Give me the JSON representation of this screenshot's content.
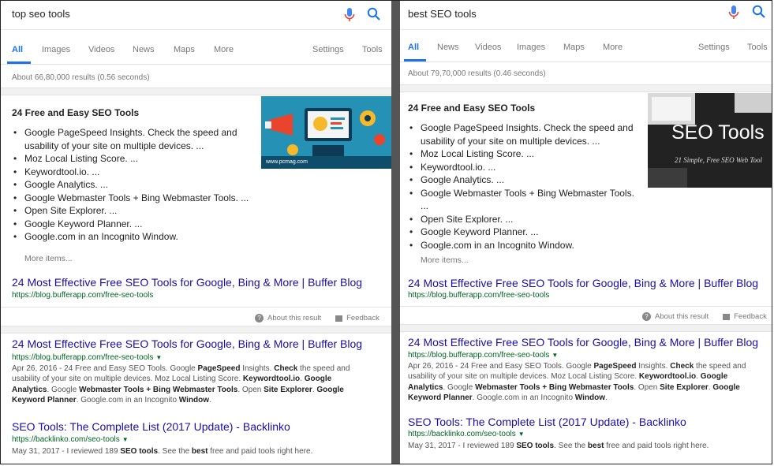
{
  "left": {
    "query": "top seo tools",
    "tabs": [
      "All",
      "Images",
      "Videos",
      "News",
      "Maps",
      "More"
    ],
    "settings_tabs": [
      "Settings",
      "Tools"
    ],
    "stats": "About 66,80,000 results (0.56 seconds)",
    "snippet": {
      "title": "24 Free and Easy SEO Tools",
      "items": [
        "Google PageSpeed Insights. Check the speed and",
        "usability of your site on multiple devices. ...",
        "Moz Local Listing Score. ...",
        "Keywordtool.io. ...",
        "Google Analytics. ...",
        "Google Webmaster Tools + Bing Webmaster Tools. ...",
        "Open Site Explorer. ...",
        "Google Keyword Planner. ...",
        "Google.com in an Incognito Window."
      ],
      "more": "More items...",
      "image_caption": "www.pcmag.com"
    },
    "featured_title": "24 Most Effective Free SEO Tools for Google, Bing & More | Buffer Blog",
    "featured_url": "https://blog.bufferapp.com/free-seo-tools",
    "about": "About this result",
    "feedback": "Feedback",
    "results": [
      {
        "title": "24 Most Effective Free SEO Tools for Google, Bing & More | Buffer Blog",
        "url": "https://blog.bufferapp.com/free-seo-tools",
        "desc_html": "Apr 26, 2016 - 24 Free and Easy SEO Tools. Google <b>PageSpeed</b> Insights. <b>Check</b> the speed and usability of your site on multiple devices. Moz Local Listing Score. <b>Keywordtool.io</b>. <b>Google Analytics</b>. Google <b>Webmaster Tools + Bing Webmaster Tools</b>. Open <b>Site Explorer</b>. <b>Google Keyword Planner</b>. Google.com in an Incognito <b>Window</b>."
      },
      {
        "title": "SEO Tools: The Complete List (2017 Update) - Backlinko",
        "url": "https://backlinko.com/seo-tools",
        "desc_html": "May 31, 2017 - I reviewed 189 <b>SEO tools</b>. See the <b>best</b> free and paid tools right here."
      }
    ]
  },
  "right": {
    "query": "best SEO tools",
    "tabs": [
      "All",
      "News",
      "Videos",
      "Images",
      "Maps",
      "More"
    ],
    "settings_tabs": [
      "Settings",
      "Tools"
    ],
    "stats": "About 79,70,000 results (0.46 seconds)",
    "snippet": {
      "title": "24 Free and Easy SEO Tools",
      "items": [
        "Google PageSpeed Insights. Check the speed and",
        "usability of your site on multiple devices. ...",
        "Moz Local Listing Score. ...",
        "Keywordtool.io. ...",
        "Google Analytics. ...",
        "Google Webmaster Tools + Bing Webmaster Tools.",
        "...",
        "Open Site Explorer. ...",
        "Google Keyword Planner. ...",
        "Google.com in an Incognito Window."
      ],
      "more": "More items...",
      "image_title": "SEO Tools",
      "image_subtitle": "21 Simple, Free SEO Web Tool"
    },
    "featured_title": "24 Most Effective Free SEO Tools for Google, Bing & More | Buffer Blog",
    "featured_url": "https://blog.bufferapp.com/free-seo-tools",
    "about": "About this result",
    "feedback": "Feedback",
    "results": [
      {
        "title": "24 Most Effective Free SEO Tools for Google, Bing & More | Buffer Blog",
        "url": "https://blog.bufferapp.com/free-seo-tools",
        "desc_html": "Apr 26, 2016 - 24 Free and Easy SEO Tools. Google <b>PageSpeed</b> Insights. <b>Check</b> the speed and usability of your site on multiple devices. Moz Local Listing Score. <b>Keywordtool.io</b>. <b>Google Analytics</b>. Google <b>Webmaster Tools + Bing Webmaster Tools</b>. Open <b>Site Explorer</b>. <b>Google Keyword Planner</b>. Google.com in an Incognito <b>Window</b>."
      },
      {
        "title": "SEO Tools: The Complete List (2017 Update) - Backlinko",
        "url": "https://backlinko.com/seo-tools",
        "desc_html": "May 31, 2017 - I reviewed 189 <b>SEO tools</b>. See the <b>best</b> free and paid tools right here."
      }
    ]
  },
  "colors": {
    "link": "#1a0dab",
    "url": "#006621",
    "accent": "#1a73e8",
    "mic_red": "#ea4335",
    "mic_blue": "#4285f4"
  },
  "icons": {
    "mic": "microphone-icon",
    "search": "magnifier-icon",
    "info": "info-icon",
    "flag": "flag-icon"
  }
}
